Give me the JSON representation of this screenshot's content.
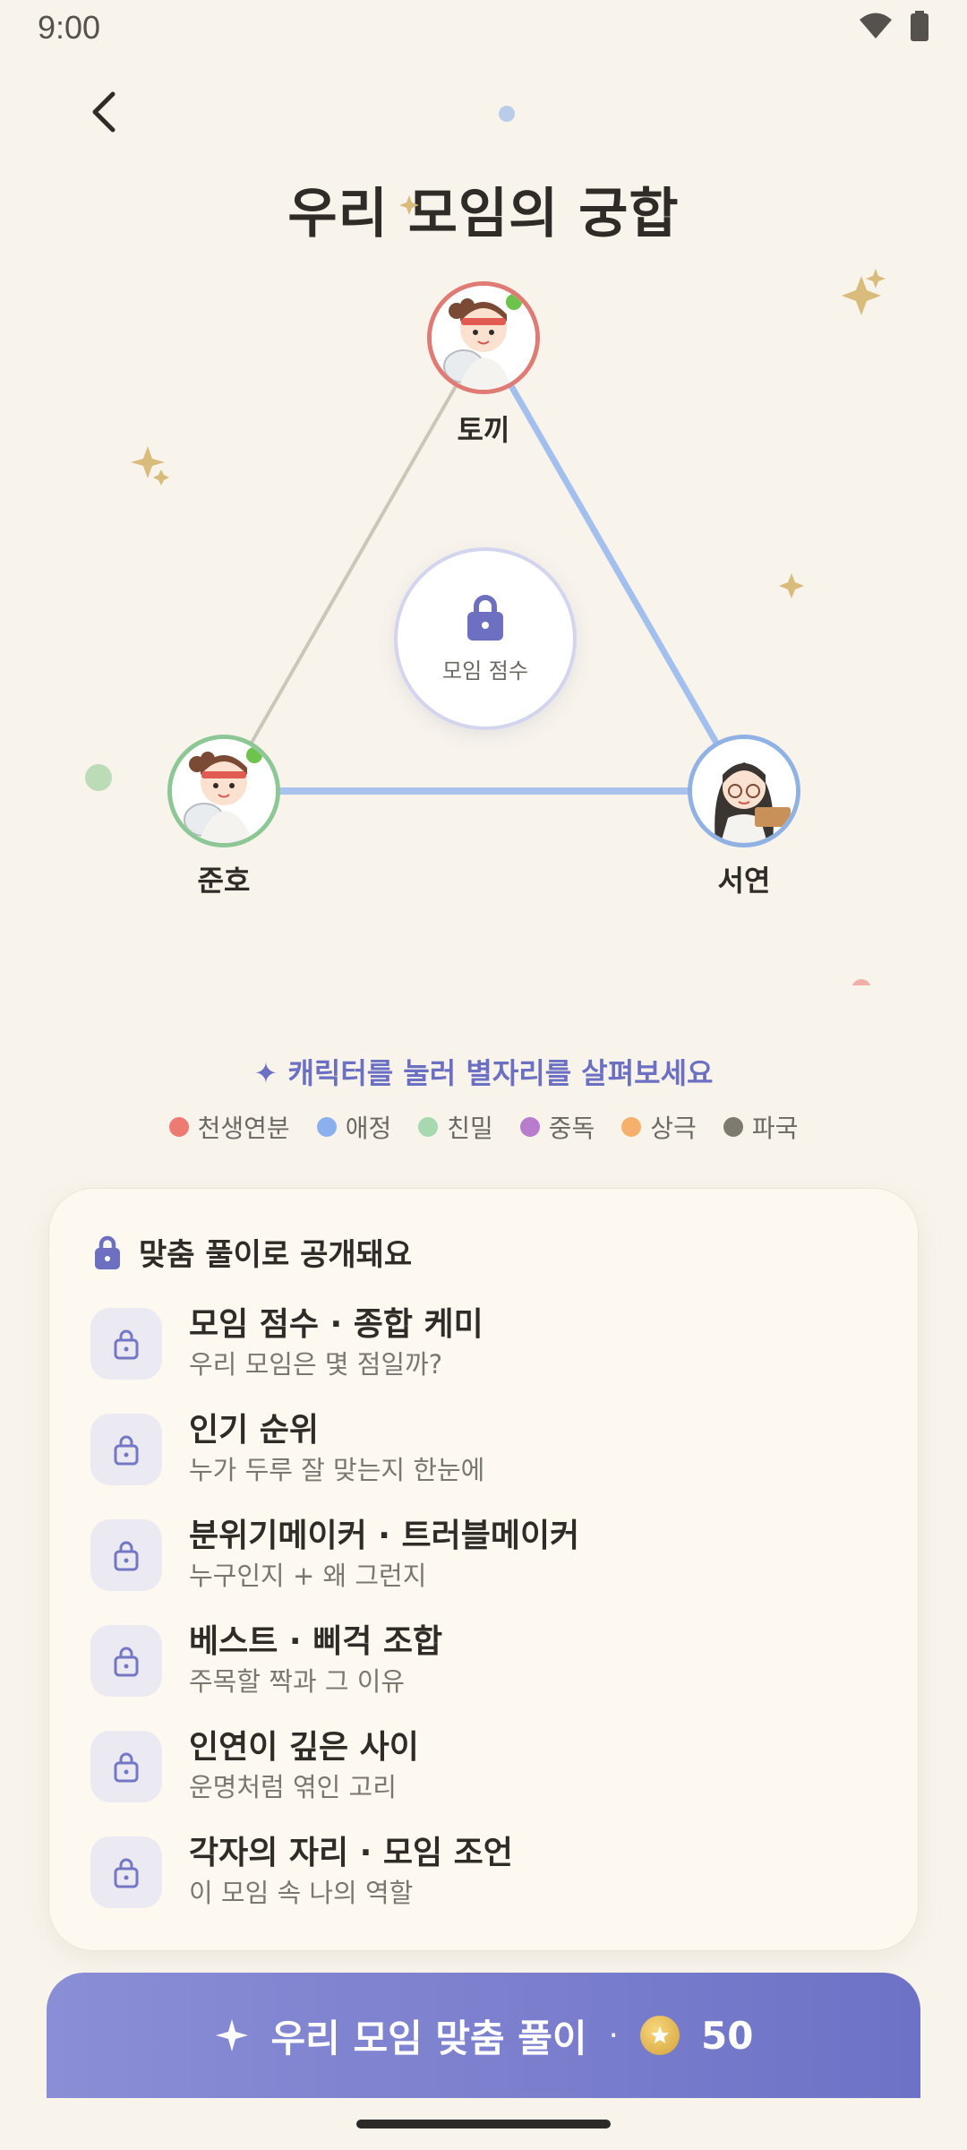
{
  "status_bar": {
    "time": "9:00"
  },
  "header": {
    "title": "우리 모임의 궁합"
  },
  "graph": {
    "nodes": [
      {
        "name": "토끼"
      },
      {
        "name": "준호"
      },
      {
        "name": "서연"
      }
    ],
    "center_label": "모임 점수",
    "edge_colors": {
      "top_left": "#c9c5b8",
      "top_right": "#9fbbed",
      "bottom": "#a9c2ee"
    }
  },
  "hint": {
    "icon": "sparkle-icon",
    "text": "캐릭터를 눌러 별자리를 살펴보세요"
  },
  "legend": [
    {
      "label": "천생연분",
      "color": "#ee7a74"
    },
    {
      "label": "애정",
      "color": "#8cb0ee"
    },
    {
      "label": "친밀",
      "color": "#a7d8b0"
    },
    {
      "label": "중독",
      "color": "#b77ccc"
    },
    {
      "label": "상극",
      "color": "#f6b06b"
    },
    {
      "label": "파국",
      "color": "#7d7a70"
    }
  ],
  "card": {
    "title": "맞춤 풀이로 공개돼요",
    "items": [
      {
        "title": "모임 점수 · 종합 케미",
        "sub": "우리 모임은 몇 점일까?"
      },
      {
        "title": "인기 순위",
        "sub": "누가 두루 잘 맞는지 한눈에"
      },
      {
        "title": "분위기메이커 · 트러블메이커",
        "sub": "누구인지 + 왜 그런지"
      },
      {
        "title": "베스트 · 삐걱 조합",
        "sub": "주목할 짝과 그 이유"
      },
      {
        "title": "인연이 깊은 사이",
        "sub": "운명처럼 엮인 고리"
      },
      {
        "title": "각자의 자리 · 모임 조언",
        "sub": "이 모임 속 나의 역할"
      }
    ]
  },
  "cta": {
    "label": "우리 모임 맞춤 풀이",
    "separator": "·",
    "price": "50"
  },
  "colors": {
    "accent": "#6e72c6",
    "lock": "#6d70c0"
  }
}
